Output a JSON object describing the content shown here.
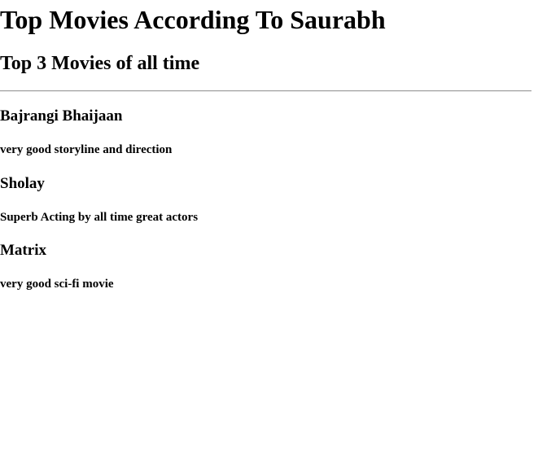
{
  "header": {
    "title": "Top Movies According To Saurabh",
    "subtitle": "Top 3 Movies of all time"
  },
  "movies": [
    {
      "title": "Bajrangi Bhaijaan",
      "description": "very good storyline and direction"
    },
    {
      "title": "Sholay",
      "description": "Superb Acting by all time great actors"
    },
    {
      "title": "Matrix",
      "description": "very good sci-fi movie"
    }
  ]
}
